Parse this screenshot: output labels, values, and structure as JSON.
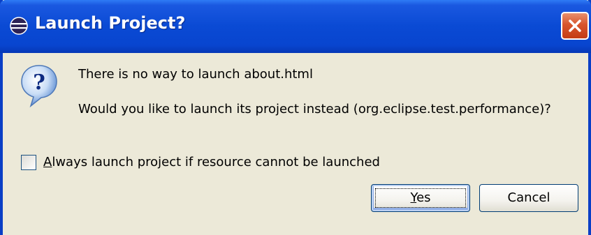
{
  "window": {
    "title": "Launch Project?"
  },
  "message": {
    "line1": "There is no way to launch about.html",
    "line2": "Would you like to launch its project instead (org.eclipse.test.performance)?"
  },
  "checkbox": {
    "mnemonic": "A",
    "label_rest": "lways launch project if resource cannot be launched",
    "checked": false
  },
  "buttons": {
    "yes_mnemonic": "Y",
    "yes_rest": "es",
    "cancel": "Cancel"
  },
  "icons": {
    "title": "eclipse-icon",
    "close": "close-icon",
    "message": "question-icon"
  },
  "colors": {
    "titlebar": "#0a4ad4",
    "close_button": "#d8552d",
    "dialog_background": "#ece9d8",
    "button_border": "#003c74"
  }
}
